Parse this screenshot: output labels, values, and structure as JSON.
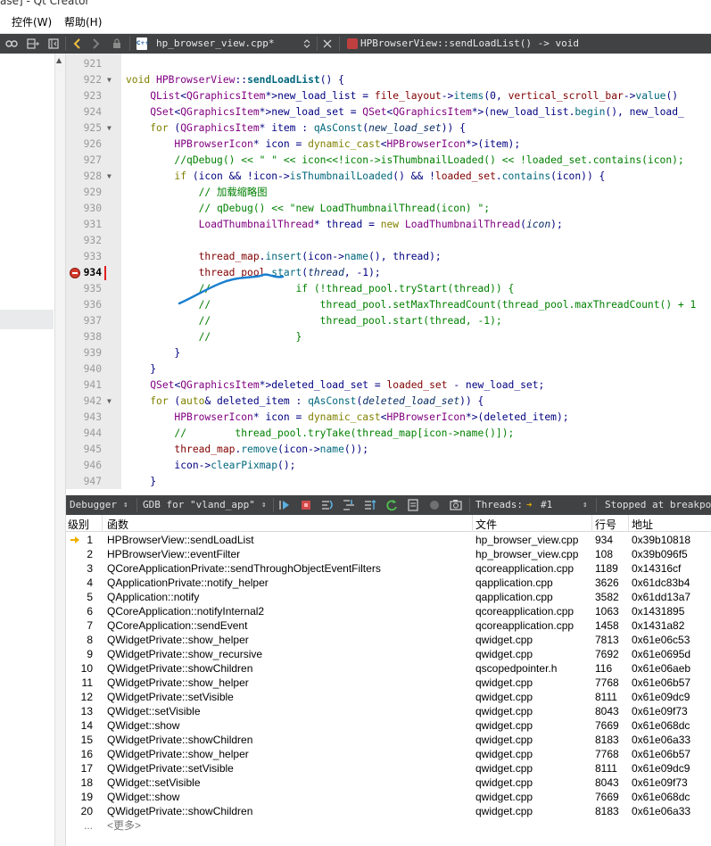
{
  "window": {
    "title_fragment": "ase] - Qt Creator"
  },
  "menubar": {
    "items": [
      "控件(W)",
      "帮助(H)"
    ]
  },
  "toolbar": {
    "file_name": "hp_browser_view.cpp*",
    "function_name": "HPBrowserView::sendLoadList() -> void"
  },
  "editor": {
    "current_line": 934,
    "lines": [
      {
        "n": 921,
        "html": ""
      },
      {
        "n": 922,
        "fold": true,
        "html": "<span class='kw'>void</span> <span class='ty'>HPBrowserView</span>::<span class='bold'>sendLoadList</span>() {"
      },
      {
        "n": 923,
        "html": "    <span class='ty'>QList</span>&lt;<span class='ty'>QGraphicsItem</span>*&gt;new_load_list = <span class='mem'>file_layout</span>-&gt;<span class='fn'>items</span>(0, <span class='mem'>vertical_scroll_bar</span>-&gt;<span class='fn'>value</span>()"
      },
      {
        "n": 924,
        "html": "    <span class='ty'>QSet</span>&lt;<span class='ty'>QGraphicsItem</span>*&gt;new_load_set = <span class='ty'>QSet</span>&lt;<span class='ty'>QGraphicsItem</span>*&gt;(new_load_list.<span class='fn'>begin</span>(), new_load_"
      },
      {
        "n": 925,
        "fold": true,
        "html": "    <span class='kw'>for</span> (<span class='ty'>QGraphicsItem</span>* item : <span class='fn'>qAsConst</span>(<span class='it'>new_load_set</span>)) {"
      },
      {
        "n": 926,
        "html": "        <span class='ty'>HPBrowserIcon</span>* icon = <span class='kw'>dynamic_cast</span>&lt;<span class='ty'>HPBrowserIcon</span>*&gt;(item);"
      },
      {
        "n": 927,
        "html": "        <span class='cm'>//qDebug() &lt;&lt; \" \" &lt;&lt; icon&lt;&lt;!icon-&gt;isThumbnailLoaded() &lt;&lt; !loaded_set.contains(icon);</span>"
      },
      {
        "n": 928,
        "fold": true,
        "html": "        <span class='kw'>if</span> (icon &amp;&amp; !icon-&gt;<span class='fn'>isThumbnailLoaded</span>() &amp;&amp; !<span class='mem'>loaded_set</span>.<span class='fn'>contains</span>(icon)) {"
      },
      {
        "n": 929,
        "html": "            <span class='cm'>// 加载缩略图</span>"
      },
      {
        "n": 930,
        "html": "            <span class='cm'>// qDebug() &lt;&lt; \"new LoadThumbnailThread(icon) \";</span>"
      },
      {
        "n": 931,
        "html": "            <span class='ty'>LoadThumbnailThread</span>* thread = <span class='kw'>new</span> <span class='ty'>LoadThumbnailThread</span>(<span class='it'>icon</span>);"
      },
      {
        "n": 932,
        "html": ""
      },
      {
        "n": 933,
        "html": "            <span class='mem'>thread_map</span>.<span class='fn'>insert</span>(icon-&gt;<span class='fn'>name</span>(), thread);"
      },
      {
        "n": 934,
        "bp": true,
        "html": "            <span class='mem'>thread_pool</span>.<span class='fn'>start</span>(<span class='it'>thread</span>, -1);"
      },
      {
        "n": 935,
        "html": "            <span class='cm'>//              if (!thread_pool.tryStart(thread)) {</span>"
      },
      {
        "n": 936,
        "html": "            <span class='cm'>//                  thread_pool.setMaxThreadCount(thread_pool.maxThreadCount() + 1</span>"
      },
      {
        "n": 937,
        "html": "            <span class='cm'>//                  thread_pool.start(thread, -1);</span>"
      },
      {
        "n": 938,
        "html": "            <span class='cm'>//              }</span>"
      },
      {
        "n": 939,
        "html": "        }"
      },
      {
        "n": 940,
        "html": "    }"
      },
      {
        "n": 941,
        "html": "    <span class='ty'>QSet</span>&lt;<span class='ty'>QGraphicsItem</span>*&gt;deleted_load_set = <span class='mem'>loaded_set</span> - new_load_set;"
      },
      {
        "n": 942,
        "fold": true,
        "html": "    <span class='kw'>for</span> (<span class='kw'>auto</span>&amp; deleted_item : <span class='fn'>qAsConst</span>(<span class='it'>deleted_load_set</span>)) {"
      },
      {
        "n": 943,
        "html": "        <span class='ty'>HPBrowserIcon</span>* icon = <span class='kw'>dynamic_cast</span>&lt;<span class='ty'>HPBrowserIcon</span>*&gt;(deleted_item);"
      },
      {
        "n": 944,
        "html": "        <span class='cm'>//        thread_pool.tryTake(thread_map[icon-&gt;name()]);</span>"
      },
      {
        "n": 945,
        "html": "        <span class='mem'>thread_map</span>.<span class='fn'>remove</span>(icon-&gt;<span class='fn'>name</span>());"
      },
      {
        "n": 946,
        "html": "        icon-&gt;<span class='fn'>clearPixmap</span>();"
      },
      {
        "n": 947,
        "html": "    }"
      }
    ]
  },
  "debugbar": {
    "debugger_label": "Debugger",
    "engine_label": "GDB for \"vland_app\"",
    "threads_label": "Threads:",
    "thread_value": "#1",
    "status": "Stopped at breakpoin"
  },
  "stack": {
    "headers": {
      "level": "级别",
      "function": "函数",
      "file": "文件",
      "line": "行号",
      "address": "地址"
    },
    "more_label": "<更多>",
    "more_dots": "...",
    "rows": [
      {
        "level": "1",
        "function": "HPBrowserView::sendLoadList",
        "file": "hp_browser_view.cpp",
        "line": "934",
        "address": "0x39b10818",
        "current": true
      },
      {
        "level": "2",
        "function": "HPBrowserView::eventFilter",
        "file": "hp_browser_view.cpp",
        "line": "108",
        "address": "0x39b096f5"
      },
      {
        "level": "3",
        "function": "QCoreApplicationPrivate::sendThroughObjectEventFilters",
        "file": "qcoreapplication.cpp",
        "line": "1189",
        "address": "0x14316cf"
      },
      {
        "level": "4",
        "function": "QApplicationPrivate::notify_helper",
        "file": "qapplication.cpp",
        "line": "3626",
        "address": "0x61dc83b4"
      },
      {
        "level": "5",
        "function": "QApplication::notify",
        "file": "qapplication.cpp",
        "line": "3582",
        "address": "0x61dd13a7"
      },
      {
        "level": "6",
        "function": "QCoreApplication::notifyInternal2",
        "file": "qcoreapplication.cpp",
        "line": "1063",
        "address": "0x1431895"
      },
      {
        "level": "7",
        "function": "QCoreApplication::sendEvent",
        "file": "qcoreapplication.cpp",
        "line": "1458",
        "address": "0x1431a82"
      },
      {
        "level": "8",
        "function": "QWidgetPrivate::show_helper",
        "file": "qwidget.cpp",
        "line": "7813",
        "address": "0x61e06c53"
      },
      {
        "level": "9",
        "function": "QWidgetPrivate::show_recursive",
        "file": "qwidget.cpp",
        "line": "7692",
        "address": "0x61e0695d"
      },
      {
        "level": "10",
        "function": "QWidgetPrivate::showChildren",
        "file": "qscopedpointer.h",
        "line": "116",
        "address": "0x61e06aeb"
      },
      {
        "level": "11",
        "function": "QWidgetPrivate::show_helper",
        "file": "qwidget.cpp",
        "line": "7768",
        "address": "0x61e06b57"
      },
      {
        "level": "12",
        "function": "QWidgetPrivate::setVisible",
        "file": "qwidget.cpp",
        "line": "8111",
        "address": "0x61e09dc9"
      },
      {
        "level": "13",
        "function": "QWidget::setVisible",
        "file": "qwidget.cpp",
        "line": "8043",
        "address": "0x61e09f73"
      },
      {
        "level": "14",
        "function": "QWidget::show",
        "file": "qwidget.cpp",
        "line": "7669",
        "address": "0x61e068dc"
      },
      {
        "level": "15",
        "function": "QWidgetPrivate::showChildren",
        "file": "qwidget.cpp",
        "line": "8183",
        "address": "0x61e06a33"
      },
      {
        "level": "16",
        "function": "QWidgetPrivate::show_helper",
        "file": "qwidget.cpp",
        "line": "7768",
        "address": "0x61e06b57"
      },
      {
        "level": "17",
        "function": "QWidgetPrivate::setVisible",
        "file": "qwidget.cpp",
        "line": "8111",
        "address": "0x61e09dc9"
      },
      {
        "level": "18",
        "function": "QWidget::setVisible",
        "file": "qwidget.cpp",
        "line": "8043",
        "address": "0x61e09f73"
      },
      {
        "level": "19",
        "function": "QWidget::show",
        "file": "qwidget.cpp",
        "line": "7669",
        "address": "0x61e068dc"
      },
      {
        "level": "20",
        "function": "QWidgetPrivate::showChildren",
        "file": "qwidget.cpp",
        "line": "8183",
        "address": "0x61e06a33"
      }
    ]
  },
  "colors": {
    "toolbar_bg": "#404244",
    "gutter_bg": "#ebebeb",
    "breakpoint": "#d33a2c",
    "current_arrow": "#f0b000",
    "annotation_stroke": "#1a7fd0"
  }
}
